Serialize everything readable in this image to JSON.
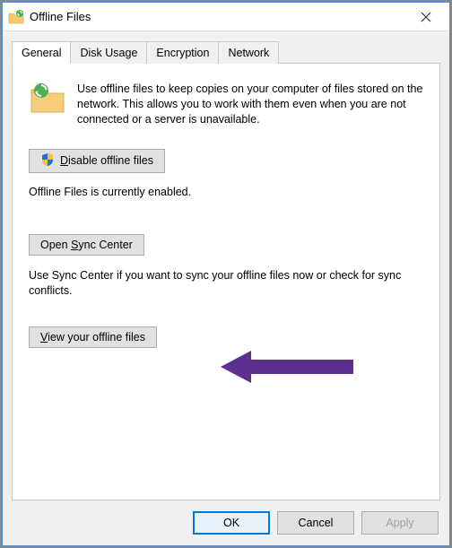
{
  "window": {
    "title": "Offline Files"
  },
  "tabs": {
    "general": "General",
    "diskUsage": "Disk Usage",
    "encryption": "Encryption",
    "network": "Network"
  },
  "content": {
    "intro": "Use offline files to keep copies on your computer of files stored on the network.  This allows you to work with them even when you are not connected or a server is unavailable.",
    "disableBtn": {
      "pre": "D",
      "rest": "isable offline files"
    },
    "status": "Offline Files is currently enabled.",
    "openSyncBtn": {
      "pre": "Open ",
      "u": "S",
      "post": "ync Center"
    },
    "syncText": "Use Sync Center if you want to sync your offline files now or check for sync conflicts.",
    "viewBtn": {
      "u": "V",
      "post": "iew your offline files"
    }
  },
  "footer": {
    "ok": "OK",
    "cancel": "Cancel",
    "apply": "Apply"
  }
}
